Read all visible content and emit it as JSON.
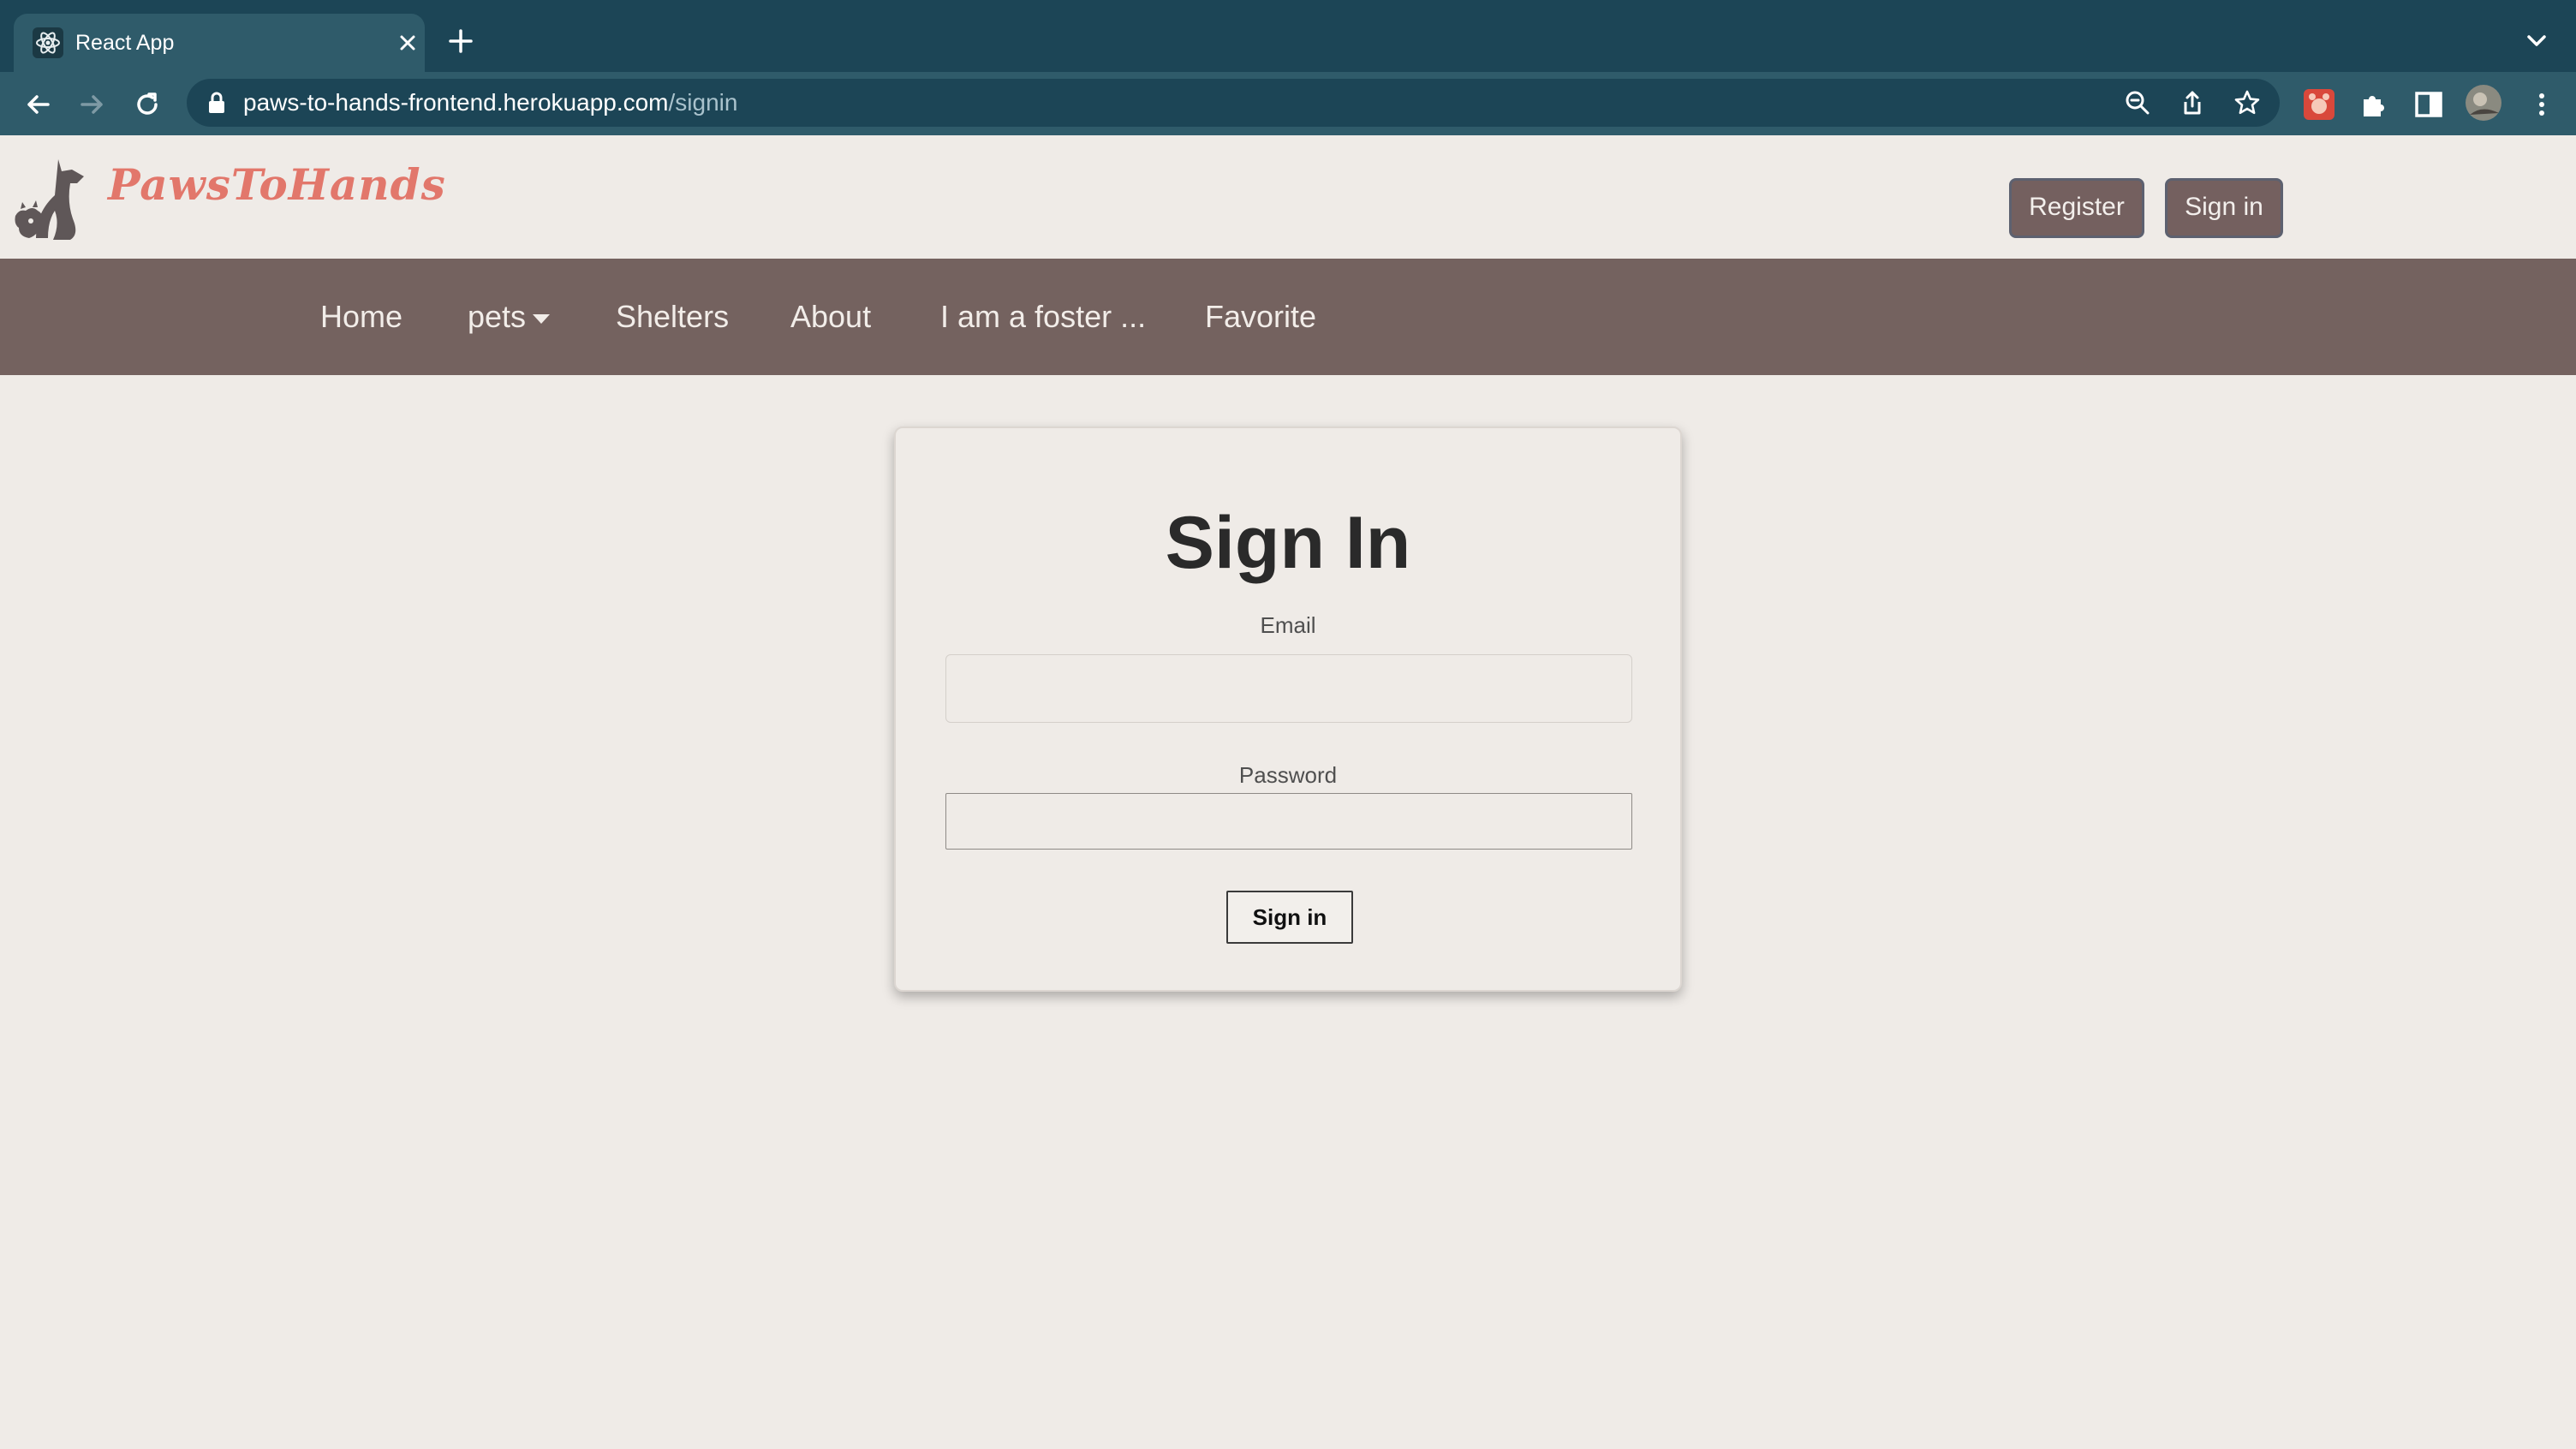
{
  "browser": {
    "tab_title": "React App",
    "url_host": "paws-to-hands-frontend.herokuapp.com",
    "url_path": "/signin",
    "theme_color": "#1c4556"
  },
  "header": {
    "brand": "PawsToHands",
    "brand_color": "#e2776b",
    "register_label": "Register",
    "signin_label": "Sign in"
  },
  "nav": {
    "home": "Home",
    "pets": "pets",
    "shelters": "Shelters",
    "about": "About",
    "foster": "I am a foster ...",
    "favorite": "Favorite",
    "bar_color": "#74625f"
  },
  "form": {
    "title": "Sign In",
    "email_label": "Email",
    "email_value": "",
    "password_label": "Password",
    "password_value": "",
    "submit_label": "Sign in"
  }
}
